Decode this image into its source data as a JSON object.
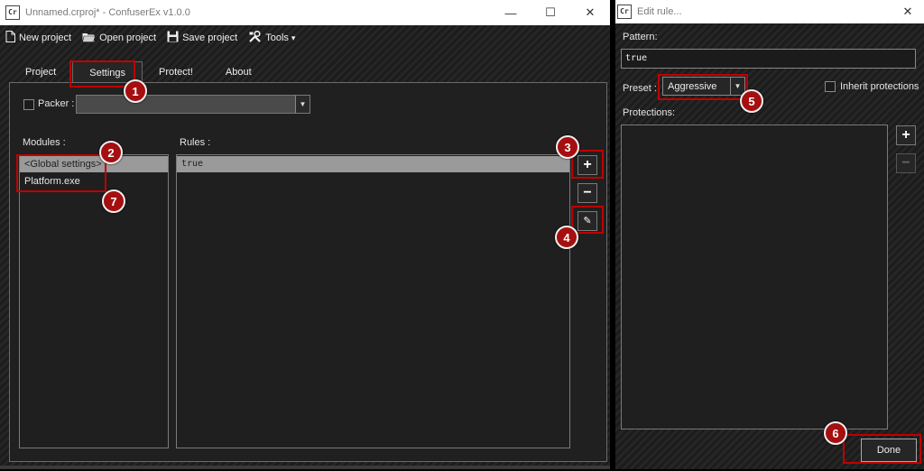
{
  "main_window": {
    "title": "Unnamed.crproj* - ConfuserEx v1.0.0",
    "app_icon_text": "Cr",
    "controls": {
      "minimize": "—",
      "maximize": "☐",
      "close": "✕"
    }
  },
  "toolbar": {
    "new_project": "New project",
    "open_project": "Open project",
    "save_project": "Save project",
    "tools": "Tools",
    "tools_arrow": "▾"
  },
  "tabs": [
    "Project",
    "Settings",
    "Protect!",
    "About"
  ],
  "settings": {
    "packer_label": "Packer :",
    "packer_value": "",
    "modules_label": "Modules :",
    "modules": [
      "<Global settings>",
      "Platform.exe"
    ],
    "rules_label": "Rules :",
    "rules": [
      "true"
    ],
    "add_rule": "+",
    "remove_rule": "−",
    "edit_rule": "✎"
  },
  "edit_window": {
    "title": "Edit rule...",
    "app_icon_text": "Cr",
    "close": "✕",
    "pattern_label": "Pattern:",
    "pattern_value": "true",
    "preset_label": "Preset :",
    "preset_value": "Aggressive",
    "inherit_label": "Inherit protections",
    "protections_label": "Protections:",
    "add_protection": "+",
    "remove_protection": "−",
    "done": "Done"
  },
  "annotations": [
    "1",
    "2",
    "3",
    "4",
    "5",
    "6",
    "7"
  ],
  "colors": {
    "annotation_red": "#c00000",
    "badge_red": "#a50f0f",
    "selected_row": "#9a9a9a"
  }
}
